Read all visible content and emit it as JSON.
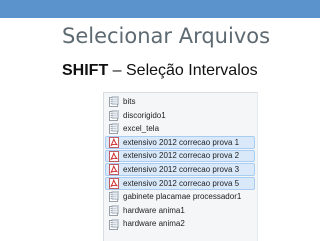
{
  "slide": {
    "title": "Selecionar Arquivos",
    "subtitle_key": "SHIFT",
    "subtitle_rest": " – Seleção Intervalos",
    "accent_color": "#5b93cc"
  },
  "file_list": {
    "items": [
      {
        "name": "bits",
        "icon": "folder-icon",
        "selected": false
      },
      {
        "name": "discorigido1",
        "icon": "folder-icon",
        "selected": false
      },
      {
        "name": "excel_tela",
        "icon": "folder-icon",
        "selected": false
      },
      {
        "name": "extensivo 2012 correcao prova 1",
        "icon": "pdf-icon",
        "selected": true
      },
      {
        "name": "extensivo 2012 correcao prova 2",
        "icon": "pdf-icon",
        "selected": true
      },
      {
        "name": "extensivo 2012 correcao prova 3",
        "icon": "pdf-icon",
        "selected": true
      },
      {
        "name": "extensivo 2012 correcao prova 5",
        "icon": "pdf-icon",
        "selected": true
      },
      {
        "name": "gabinete placamae processador1",
        "icon": "folder-icon",
        "selected": false
      },
      {
        "name": "hardware anima1",
        "icon": "folder-icon",
        "selected": false
      },
      {
        "name": "hardware anima2",
        "icon": "folder-icon",
        "selected": false
      }
    ]
  }
}
